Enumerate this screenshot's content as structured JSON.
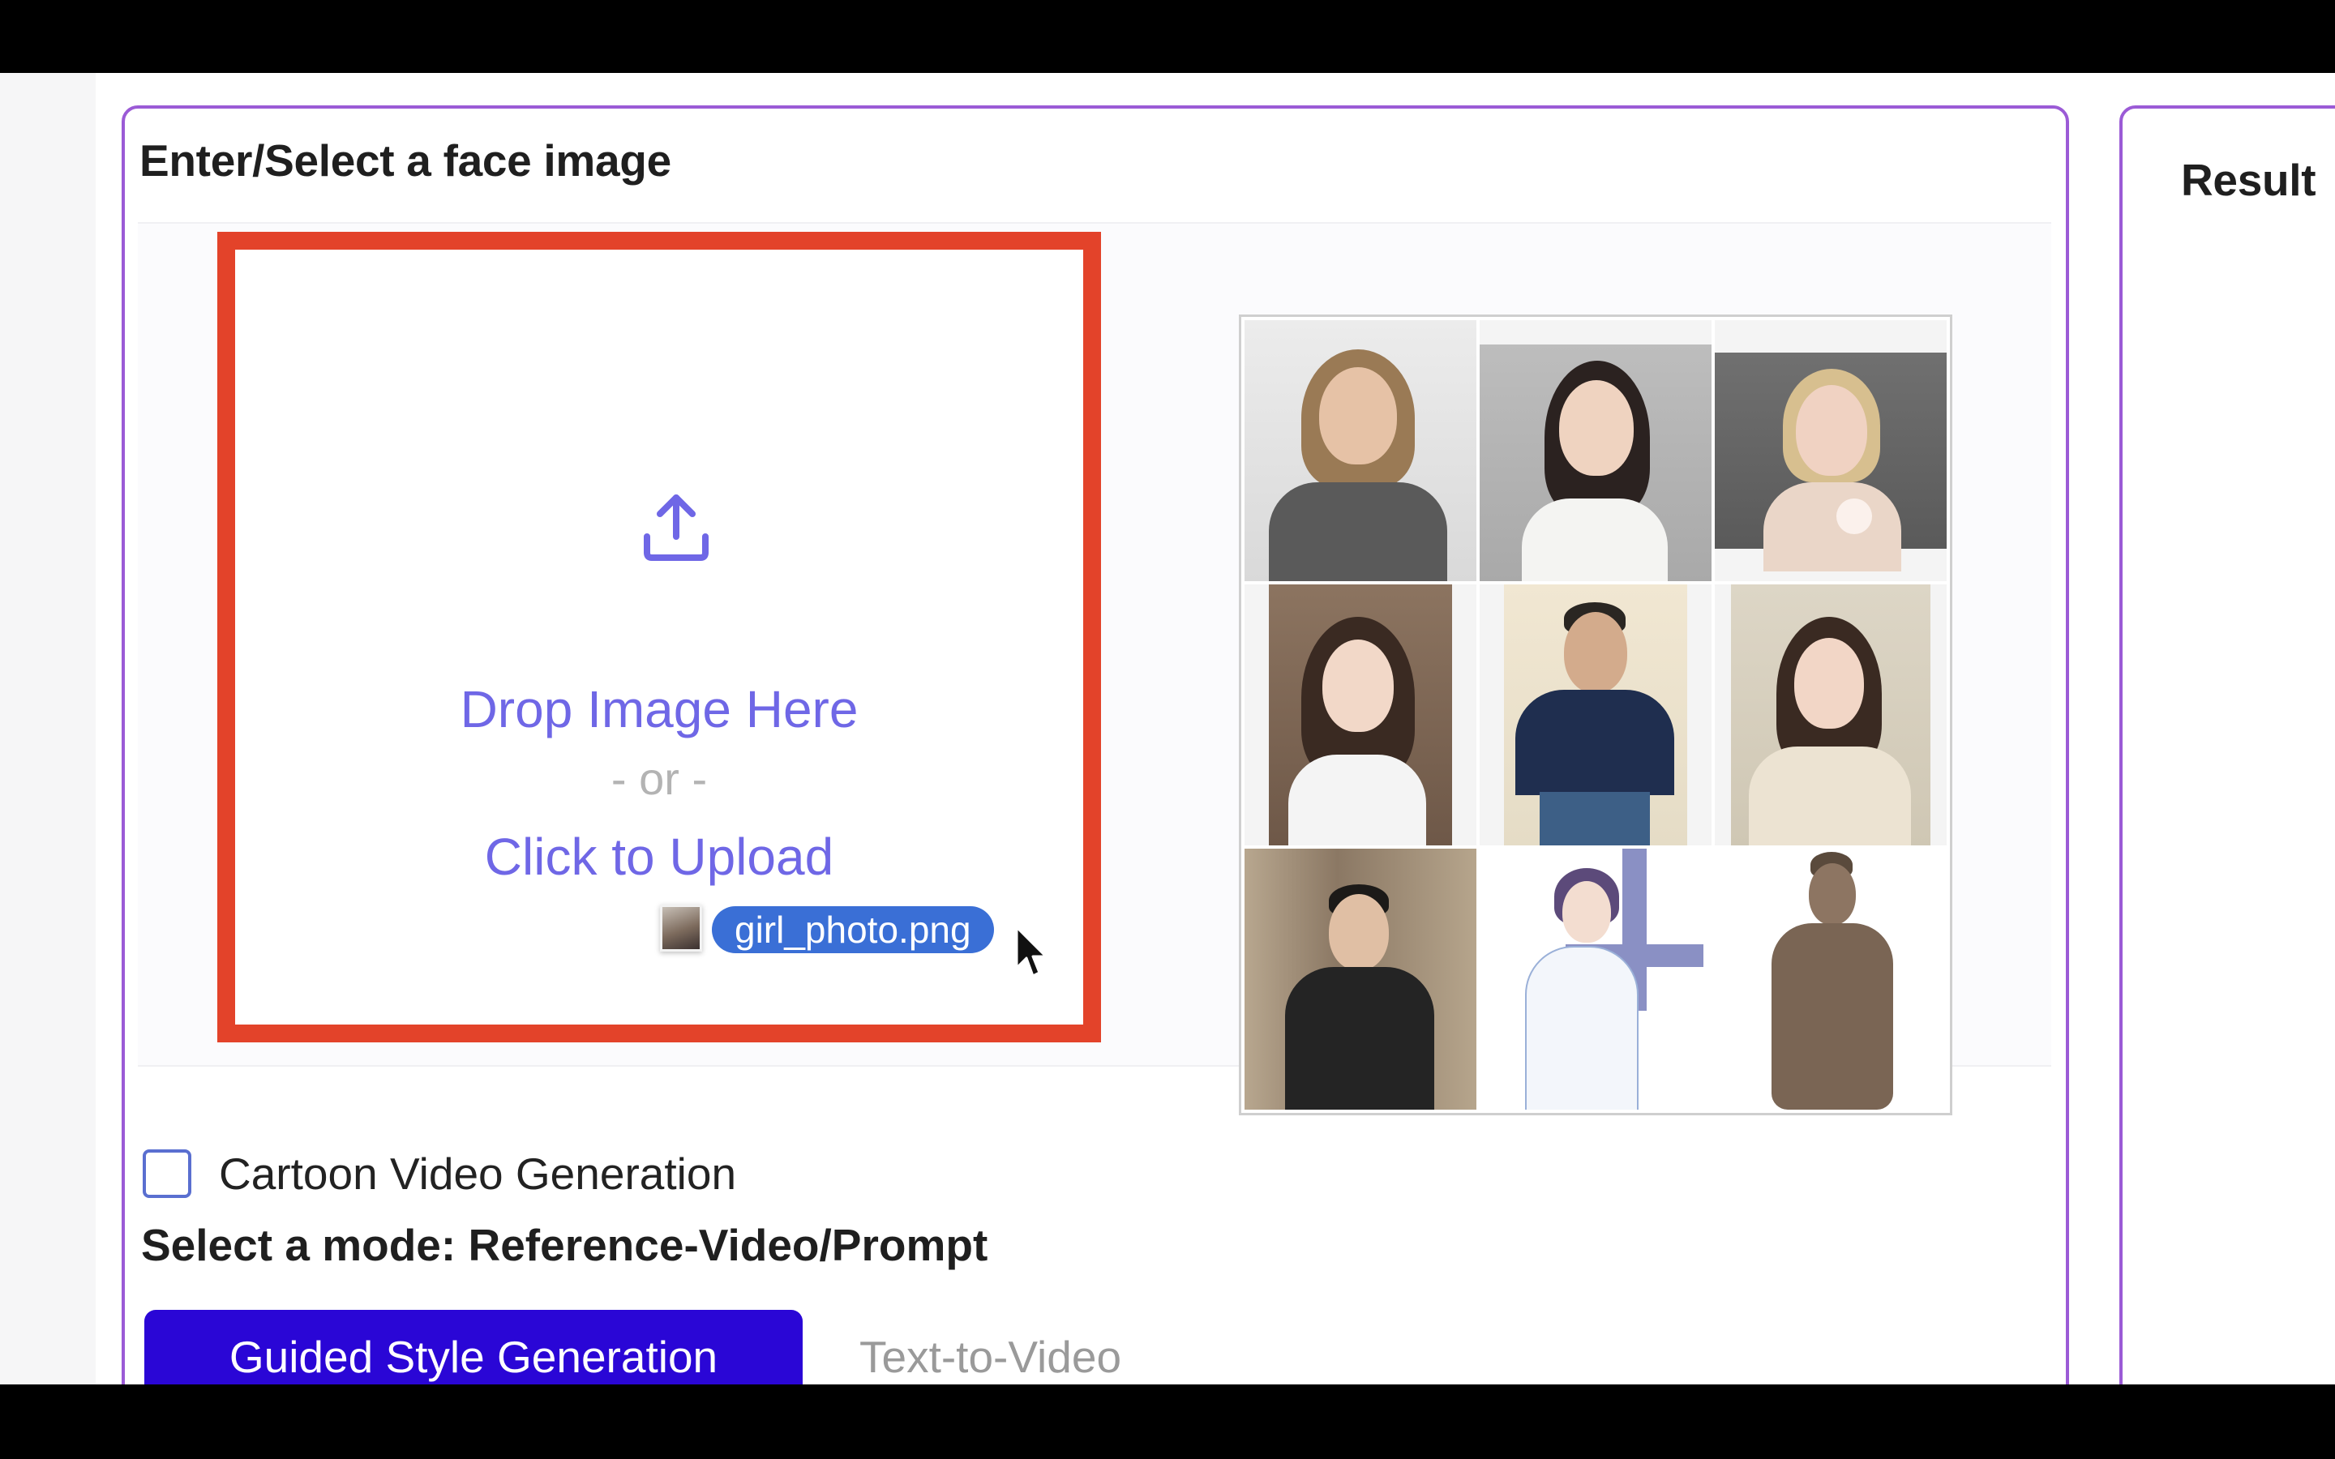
{
  "input_panel": {
    "title": "Enter/Select a face image"
  },
  "upload": {
    "drop_text": "Drop Image Here",
    "or_text": "- or -",
    "click_text": "Click to Upload",
    "dragging_file": "girl_photo.png",
    "icon": "upload-icon"
  },
  "gallery": {
    "items": [
      {
        "name": "woman-gray-tshirt"
      },
      {
        "name": "woman-white-top"
      },
      {
        "name": "woman-holding-flower"
      },
      {
        "name": "woman-white-shirt-hand-to-face"
      },
      {
        "name": "man-navy-bomber-jacket"
      },
      {
        "name": "woman-cream-sweater"
      },
      {
        "name": "young-man-black-jacket"
      },
      {
        "name": "anime-doctor-white-coat"
      },
      {
        "name": "terracotta-warrior-statue"
      }
    ]
  },
  "options": {
    "cartoon_label": "Cartoon Video Generation",
    "cartoon_checked": false
  },
  "mode": {
    "label": "Select a mode: Reference-Video/Prompt",
    "tabs": [
      {
        "label": "Guided Style Generation",
        "active": true
      },
      {
        "label": "Text-to-Video",
        "active": false
      }
    ]
  },
  "result_panel": {
    "title": "Result"
  },
  "colors": {
    "panel_border": "#9b5bd6",
    "highlight_border": "#e3432a",
    "accent_text": "#6f67e6",
    "active_tab": "#2a06d6",
    "drag_label": "#3a6fd6"
  }
}
